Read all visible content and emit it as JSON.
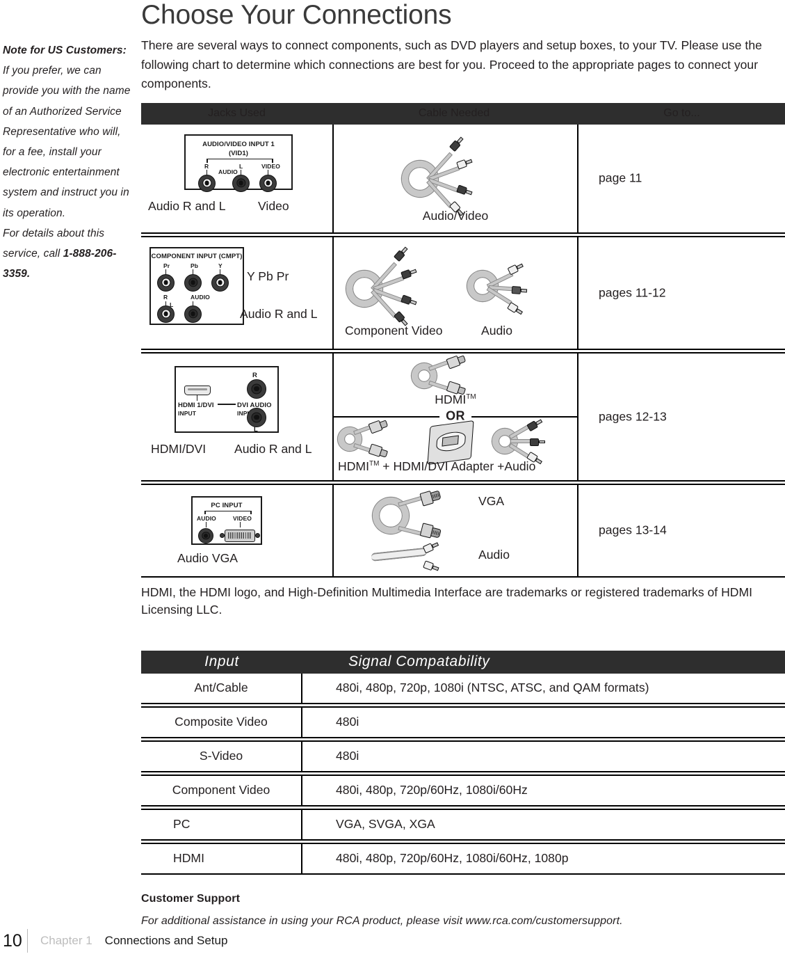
{
  "page": {
    "title": "Choose Your Connections",
    "intro": "There are several ways to connect components, such as DVD players and setup boxes, to your TV. Please use the following chart to determine which connections are best for you. Proceed to the appropriate pages to connect your components.",
    "trademark_note": "HDMI, the HDMI logo, and High-Definition Multimedia Interface are trademarks or registered trademarks of HDMI Licensing LLC."
  },
  "side_note": {
    "bold_lead": "Note for US Customers:",
    "body": " If you prefer, we can provide you with the name of an Authorized Service Representative who will, for a fee, install your electronic entertainment system and instruct you in its operation.",
    "body2": "For details about this service, call ",
    "phone": "1-888-206-3359."
  },
  "connections_table": {
    "headers": [
      "Jacks Used",
      "Cable Needed",
      "Go to..."
    ],
    "rows": [
      {
        "jack_panel": {
          "title": "AUDIO/VIDEO INPUT 1",
          "subtitle": "(VID1)",
          "labels": [
            "R",
            "AUDIO",
            "L",
            "VIDEO"
          ]
        },
        "jack_captions": [
          "Audio R and L",
          "Video"
        ],
        "cable_captions": [
          "Audio/Video"
        ],
        "goto": "page 11"
      },
      {
        "jack_panel": {
          "title": "COMPONENT INPUT  (CMPT)",
          "labels": [
            "Pr",
            "Pb",
            "Y",
            "R",
            "AUDIO",
            "L"
          ]
        },
        "jack_captions": [
          "Y Pb Pr",
          "Audio R and L"
        ],
        "cable_captions": [
          "Component Video",
          "Audio"
        ],
        "goto": "pages 11-12"
      },
      {
        "jack_panel": {
          "labels": [
            "R",
            "HDMI 1/DVI",
            "INPUT",
            "DVI AUDIO",
            "INPUT",
            "L"
          ]
        },
        "jack_captions": [
          "HDMI/DVI",
          "Audio R and L"
        ],
        "cable_captions_top": "HDMI",
        "or_label": "OR",
        "cable_captions_bottom": [
          "HDMI",
          " +  HDMI/DVI Adapter +",
          "Audio"
        ],
        "goto": "pages 12-13"
      },
      {
        "jack_panel": {
          "title": "PC INPUT",
          "labels": [
            "AUDIO",
            "VIDEO"
          ]
        },
        "jack_captions": [
          "Audio  VGA"
        ],
        "cable_captions": [
          "VGA",
          "Audio"
        ],
        "goto": "pages 13-14"
      }
    ]
  },
  "signal_table": {
    "headers": [
      "Input",
      "Signal Compatability"
    ],
    "rows": [
      {
        "input": "Ant/Cable",
        "signal": "480i, 480p, 720p, 1080i (NTSC, ATSC, and QAM formats)"
      },
      {
        "input": "Composite Video",
        "signal": "480i"
      },
      {
        "input": "S-Video",
        "signal": "480i"
      },
      {
        "input": "Component  Video",
        "signal": "480i, 480p, 720p/60Hz, 1080i/60Hz"
      },
      {
        "input": "PC",
        "signal": "VGA, SVGA, XGA"
      },
      {
        "input": "HDMI",
        "signal": "480i, 480p, 720p/60Hz, 1080i/60Hz, 1080p"
      }
    ]
  },
  "customer_support": {
    "heading": "Customer Support",
    "body": "For additional assistance in using your RCA product, please visit www.rca.com/customersupport."
  },
  "footer": {
    "page_number": "10",
    "chapter": "Chapter 1",
    "section": "Connections and Setup"
  },
  "colors": {
    "header_bar": "#2e2e2e",
    "title_gray": "#3a3a3a",
    "footer_chapter_gray": "#bdbdbd"
  }
}
